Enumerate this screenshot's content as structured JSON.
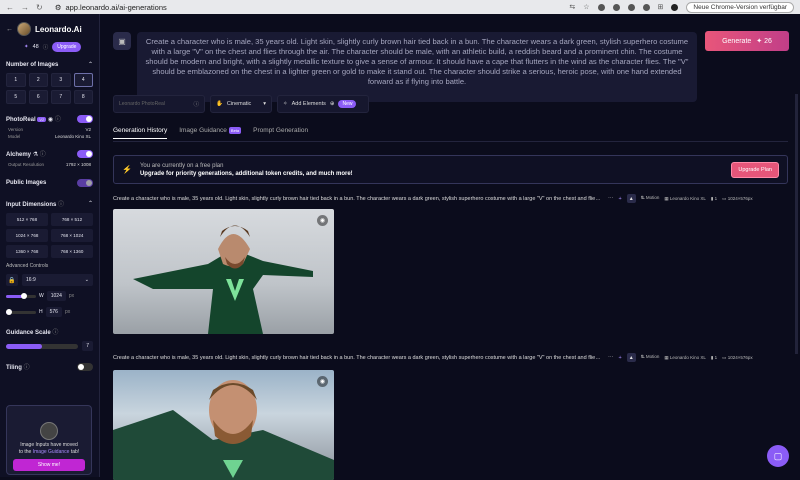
{
  "browser": {
    "url": "app.leonardo.ai/ai-generations",
    "update_label": "Neue Chrome-Version verfügbar"
  },
  "sidebar": {
    "brand": "Leonardo.Ai",
    "tokens": "48",
    "upgrade_label": "Upgrade",
    "num_images_label": "Number of Images",
    "num_options": [
      "1",
      "2",
      "3",
      "4",
      "5",
      "6",
      "7",
      "8"
    ],
    "photoreal_label": "PhotoReal",
    "photoreal_version_badge": "V2",
    "version_key": "Version",
    "version_val": "V2",
    "model_key": "Model",
    "model_val": "Leonardo Kino XL",
    "alchemy_label": "Alchemy",
    "output_res_key": "Output Resolution",
    "output_res_val": "1792 × 1008",
    "public_images_label": "Public Images",
    "input_dims_label": "Input Dimensions",
    "dims": [
      "512 × 768",
      "768 × 512",
      "1024 × 768",
      "768 × 1024",
      "1360 × 768",
      "768 × 1360"
    ],
    "advanced_label": "Advanced Controls",
    "ratio": "16:9",
    "width_label": "W",
    "width_val": "1024",
    "height_label": "H",
    "height_val": "576",
    "unit": "px",
    "guidance_label": "Guidance Scale",
    "guidance_val": "7",
    "tiling_label": "Tiling",
    "card_text_1": "Image Inputs have moved",
    "card_text_2": "to the",
    "card_link": "Image Guidance",
    "card_text_3": "tab!",
    "showme": "Show me!"
  },
  "main": {
    "prompt": "Create a character who is male, 35 years old. Light skin, slightly curly brown hair tied back in a bun. The character wears a dark green, stylish superhero costume with a large \"V\" on the chest and flies through the air. The character should be male, with an athletic build, a reddish beard and a prominent chin. The costume should be modern and bright, with a slightly metallic texture to give a sense of armour. It should have a cape that flutters in the wind as the character flies. The \"V\" should be emblazoned on the chest in a lighter green or gold to make it stand out. The character should strike a serious, heroic pose, with one hand extended forward as if flying into battle.",
    "generate_label": "Generate",
    "generate_cost": "26",
    "model_placeholder": "Leonardo PhotoReal",
    "style_label": "Cinematic",
    "add_elements_label": "Add Elements",
    "new_badge": "New",
    "tabs": [
      "Generation History",
      "Image Guidance",
      "Prompt Generation"
    ],
    "beta_badge": "Beta",
    "banner_line1": "You are currently on a free plan",
    "banner_line2": "Upgrade for priority generations, additional token credits, and much more!",
    "banner_button": "Upgrade Plan",
    "gen_prompt_short": "Create a character who is male, 35 years old. Light skin, slightly curly brown hair tied back in a bun. The character wears a dark green, stylish superhero costume with a large \"V\" on the chest and flies through the air.",
    "meta_motion": "Motion",
    "meta_model": "Leonardo Kino XL",
    "meta_count": "1",
    "meta_size": "1024×576px"
  }
}
